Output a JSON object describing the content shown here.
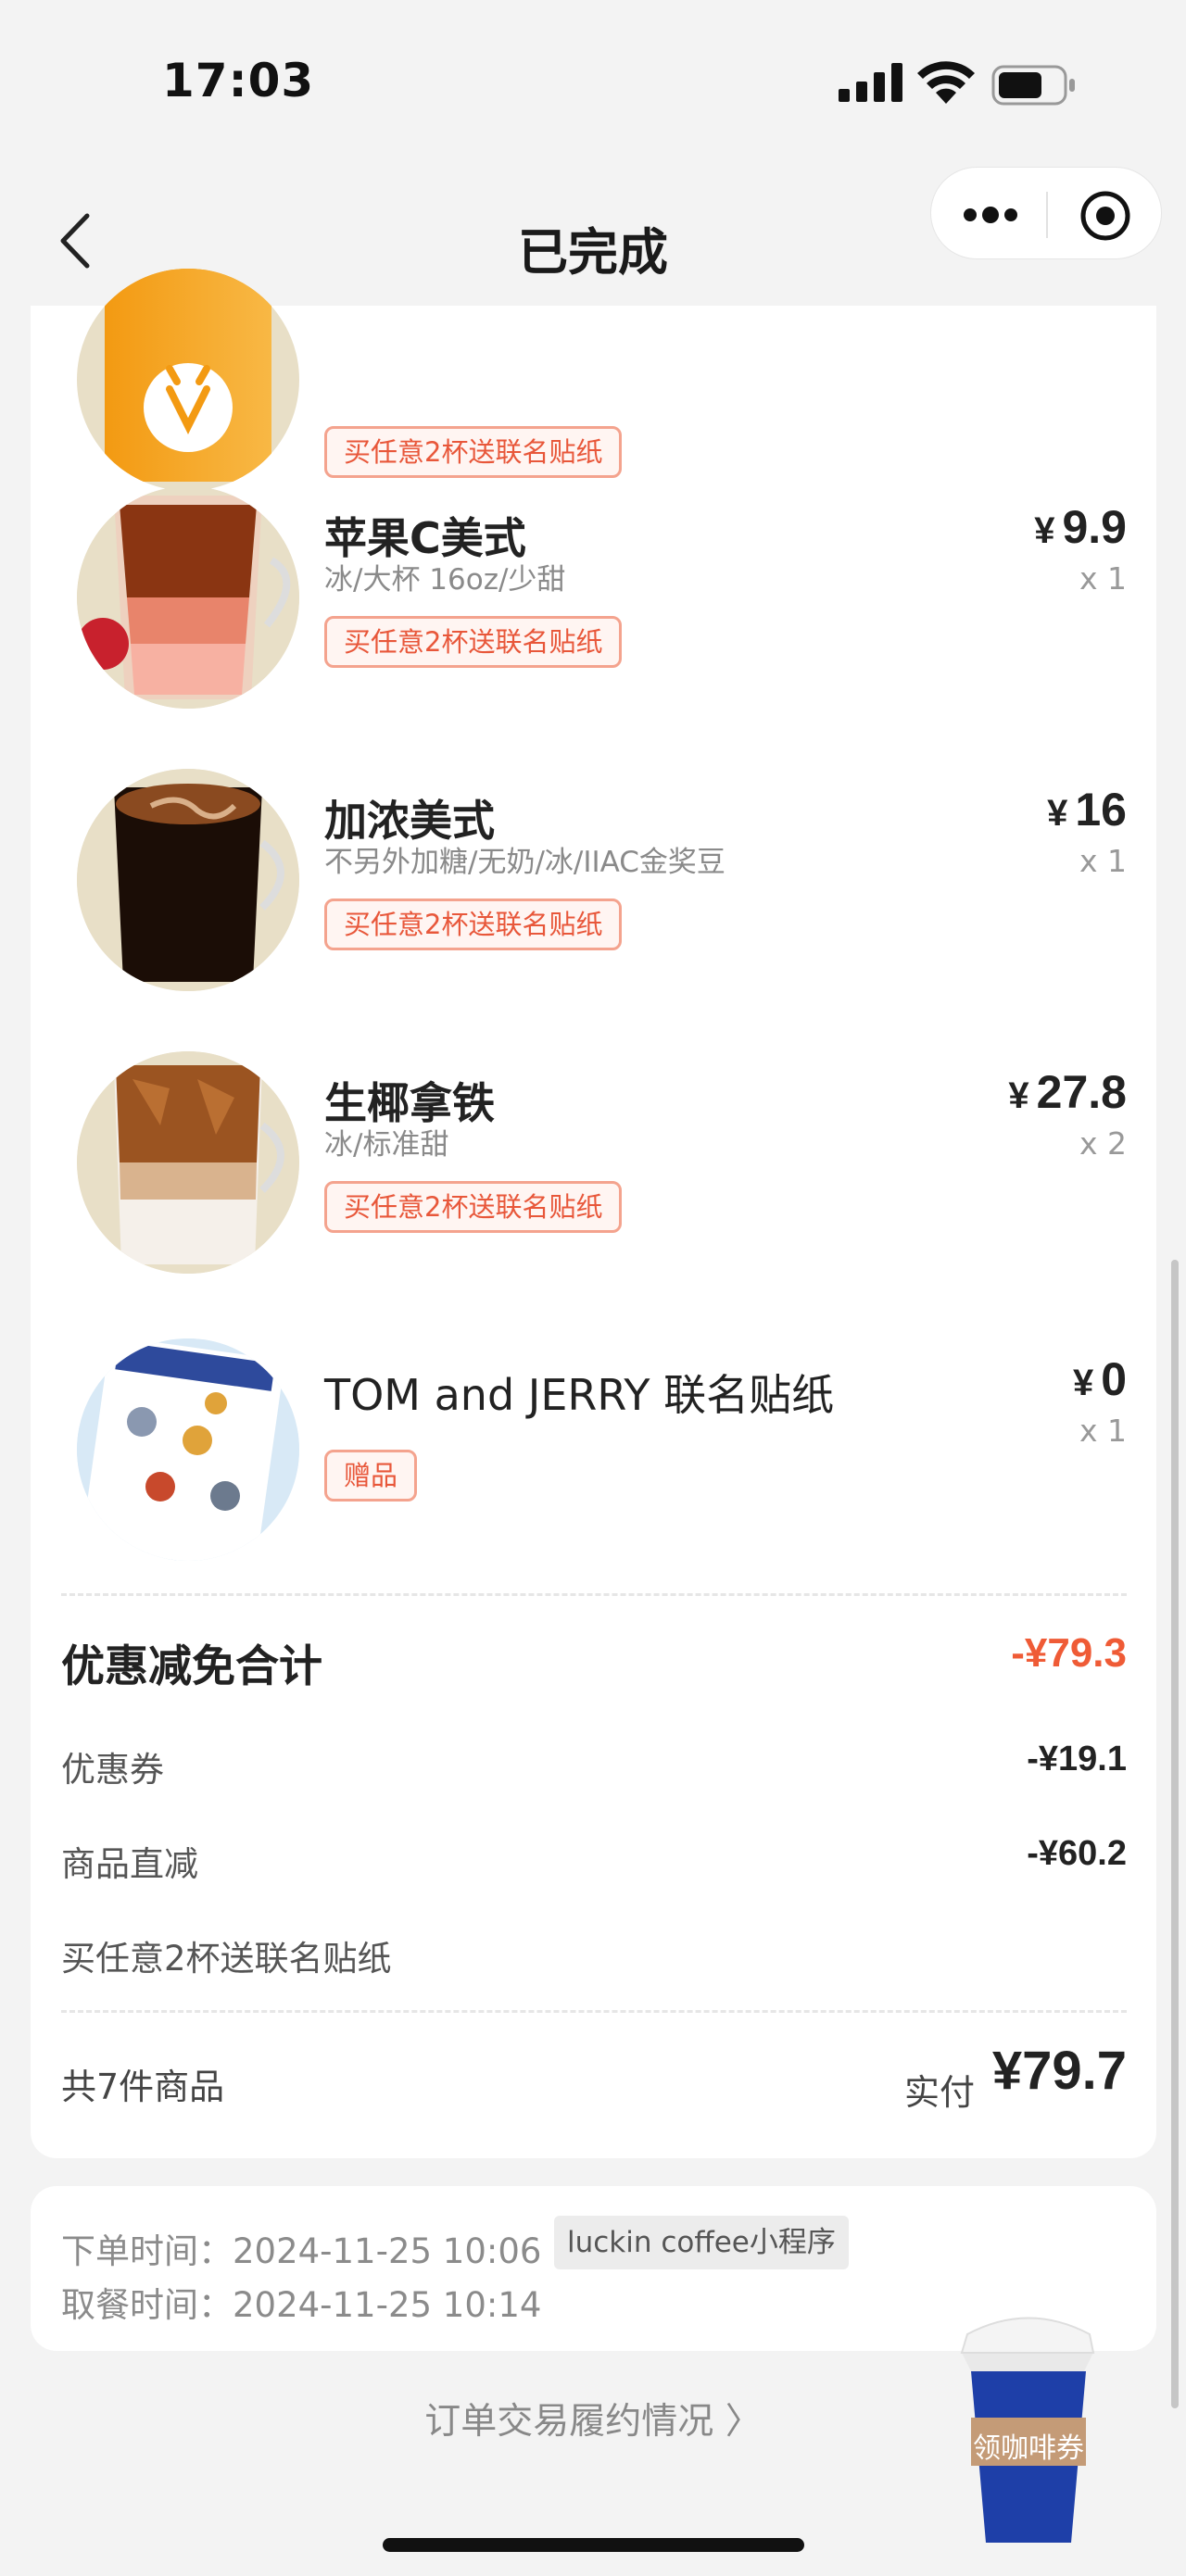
{
  "status": {
    "time": "17:03"
  },
  "nav": {
    "title": "已完成"
  },
  "items": [
    {
      "name": "",
      "spec": "",
      "tag": "买任意2杯送联名贴纸",
      "price": "",
      "qty": ""
    },
    {
      "name": "苹果C美式",
      "spec": "冰/大杯 16oz/少甜",
      "tag": "买任意2杯送联名贴纸",
      "price": "9.9",
      "qty": "x 1"
    },
    {
      "name": "加浓美式",
      "spec": "不另外加糖/无奶/冰/IIAC金奖豆",
      "tag": "买任意2杯送联名贴纸",
      "price": "16",
      "qty": "x 1"
    },
    {
      "name": "生椰拿铁",
      "spec": "冰/标准甜",
      "tag": "买任意2杯送联名贴纸",
      "price": "27.8",
      "qty": "x 2"
    },
    {
      "name": "TOM and JERRY 联名贴纸",
      "spec": "",
      "tag": "赠品",
      "price": "0",
      "qty": "x 1"
    }
  ],
  "currency": "¥",
  "summary": {
    "discount_title": "优惠减免合计",
    "discount_total": "-¥79.3",
    "rows": [
      {
        "label": "优惠券",
        "value": "-¥19.1"
      },
      {
        "label": "商品直减",
        "value": "-¥60.2"
      },
      {
        "label": "买任意2杯送联名贴纸",
        "value": ""
      }
    ],
    "count_label": "共7件商品",
    "paid_label": "实付",
    "paid_value": "¥79.7"
  },
  "order_info": {
    "order_time": "下单时间：2024-11-25 10:06",
    "source": "luckin coffee小程序",
    "pickup_time": "取餐时间：2024-11-25 10:14"
  },
  "footer": {
    "trace_link": "订单交易履约情况 〉"
  },
  "float_button": {
    "label": "领咖啡券"
  },
  "colors": {
    "accent": "#ef5b36",
    "tag_border": "#f4a38e",
    "cup_blue": "#1e3fa8"
  }
}
